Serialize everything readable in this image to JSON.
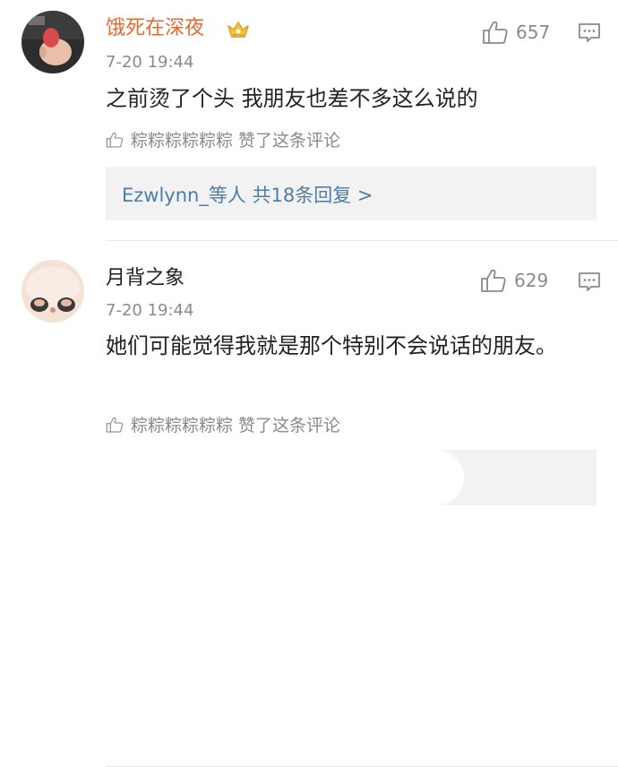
{
  "comments": [
    {
      "username": "饿死在深夜",
      "vip_badge_icon": "crown-icon",
      "timestamp": "7-20 19:44",
      "like_count": "657",
      "text": "之前烫了个头 我朋友也差不多这么说的",
      "liked_by": "粽粽粽粽粽粽 赞了这条评论",
      "replies_label": "Ezwlynn_等人  共18条回复 >",
      "username_color": "#e8692e"
    },
    {
      "username": "月背之象",
      "timestamp": "7-20 19:44",
      "like_count": "629",
      "text": "她们可能觉得我就是那个特别不会说话的朋友。",
      "liked_by": "粽粽粽粽粽粽 赞了这条评论"
    }
  ],
  "colors": {
    "link": "#4f7ca8",
    "meta": "#8a8a8a",
    "reply_bg": "#f2f2f2"
  }
}
